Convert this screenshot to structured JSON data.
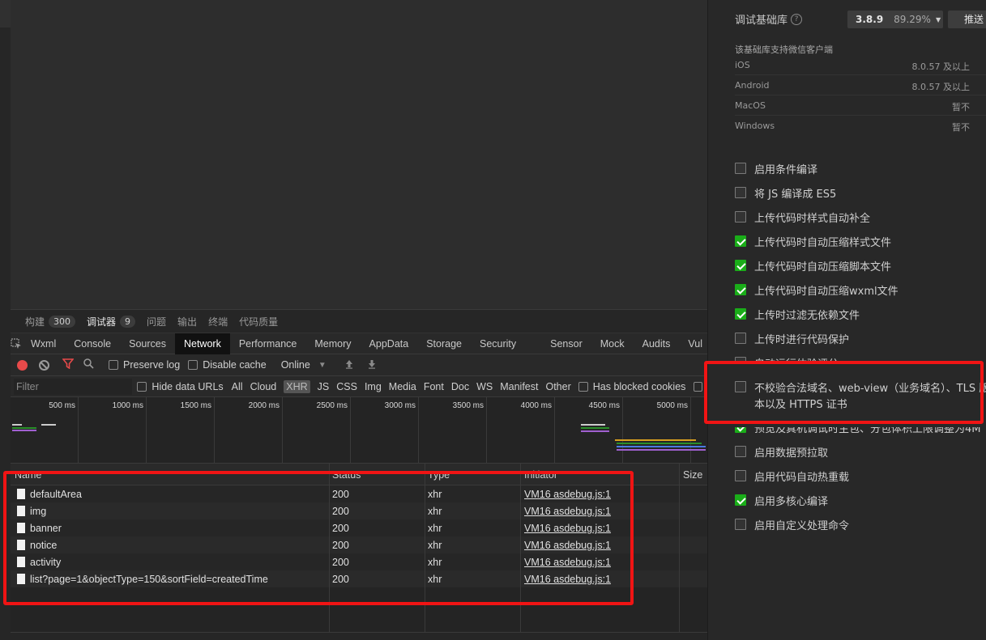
{
  "devtools": {
    "top_tabs": [
      {
        "label": "构建",
        "badge": "300"
      },
      {
        "label": "调试器",
        "badge": "9"
      },
      {
        "label": "问题"
      },
      {
        "label": "输出"
      },
      {
        "label": "终端"
      },
      {
        "label": "代码质量"
      }
    ],
    "panel_tabs": [
      "Wxml",
      "Console",
      "Sources",
      "Network",
      "Performance",
      "Memory",
      "AppData",
      "Storage",
      "Security",
      "Sensor",
      "Mock",
      "Audits",
      "Vul"
    ],
    "active_panel": "Network",
    "toolbar": {
      "preserve_log": "Preserve log",
      "disable_cache": "Disable cache",
      "throttle": "Online"
    },
    "filterbar": {
      "placeholder": "Filter",
      "hide_data_urls": "Hide data URLs",
      "types": [
        "All",
        "Cloud",
        "XHR",
        "JS",
        "CSS",
        "Img",
        "Media",
        "Font",
        "Doc",
        "WS",
        "Manifest",
        "Other"
      ],
      "selected_type": "XHR",
      "blocked_cookies": "Has blocked cookies"
    },
    "timeline_ticks": [
      "500 ms",
      "1000 ms",
      "1500 ms",
      "2000 ms",
      "2500 ms",
      "3000 ms",
      "3500 ms",
      "4000 ms",
      "4500 ms",
      "5000 ms"
    ],
    "columns": {
      "name": "Name",
      "status": "Status",
      "type": "Type",
      "initiator": "Initiator",
      "size": "Size"
    },
    "requests": [
      {
        "name": "defaultArea",
        "status": "200",
        "type": "xhr",
        "initiator": "VM16 asdebug.js:1"
      },
      {
        "name": "img",
        "status": "200",
        "type": "xhr",
        "initiator": "VM16 asdebug.js:1"
      },
      {
        "name": "banner",
        "status": "200",
        "type": "xhr",
        "initiator": "VM16 asdebug.js:1"
      },
      {
        "name": "notice",
        "status": "200",
        "type": "xhr",
        "initiator": "VM16 asdebug.js:1"
      },
      {
        "name": "activity",
        "status": "200",
        "type": "xhr",
        "initiator": "VM16 asdebug.js:1"
      },
      {
        "name": "list?page=1&objectType=150&sortField=createdTime",
        "status": "200",
        "type": "xhr",
        "initiator": "VM16 asdebug.js:1"
      }
    ]
  },
  "settings": {
    "lib_label": "调试基础库",
    "lib_version": "3.8.9",
    "lib_percent": "89.29%",
    "push_button": "推送",
    "support_title": "该基础库支持微信客户端",
    "platforms": [
      {
        "name": "iOS",
        "value": "8.0.57 及以上"
      },
      {
        "name": "Android",
        "value": "8.0.57 及以上"
      },
      {
        "name": "MacOS",
        "value": "暂不"
      },
      {
        "name": "Windows",
        "value": "暂不"
      }
    ],
    "options": [
      {
        "label": "启用条件编译",
        "checked": false
      },
      {
        "label": "将 JS 编译成 ES5",
        "checked": false
      },
      {
        "label": "上传代码时样式自动补全",
        "checked": false
      },
      {
        "label": "上传代码时自动压缩样式文件",
        "checked": true
      },
      {
        "label": "上传代码时自动压缩脚本文件",
        "checked": true
      },
      {
        "label": "上传代码时自动压缩wxml文件",
        "checked": true
      },
      {
        "label": "上传时过滤无依赖文件",
        "checked": true
      },
      {
        "label": "上传时进行代码保护",
        "checked": false
      },
      {
        "label": "自动运行体验评分",
        "checked": false
      },
      {
        "label": "不校验合法域名、web-view（业务域名）、TLS 版",
        "line2": "本以及 HTTPS 证书",
        "checked": false
      },
      {
        "label": "预览及真机调试时主包、分包体积上限调整为4M",
        "checked": true
      },
      {
        "label": "启用数据预拉取",
        "checked": false
      },
      {
        "label": "启用代码自动热重载",
        "checked": false
      },
      {
        "label": "启用多核心编译",
        "checked": true
      },
      {
        "label": "启用自定义处理命令",
        "checked": false
      }
    ]
  },
  "colors": {
    "accent_green": "#1aad19",
    "highlight_red": "#f01414",
    "record_red": "#e84a4a"
  }
}
